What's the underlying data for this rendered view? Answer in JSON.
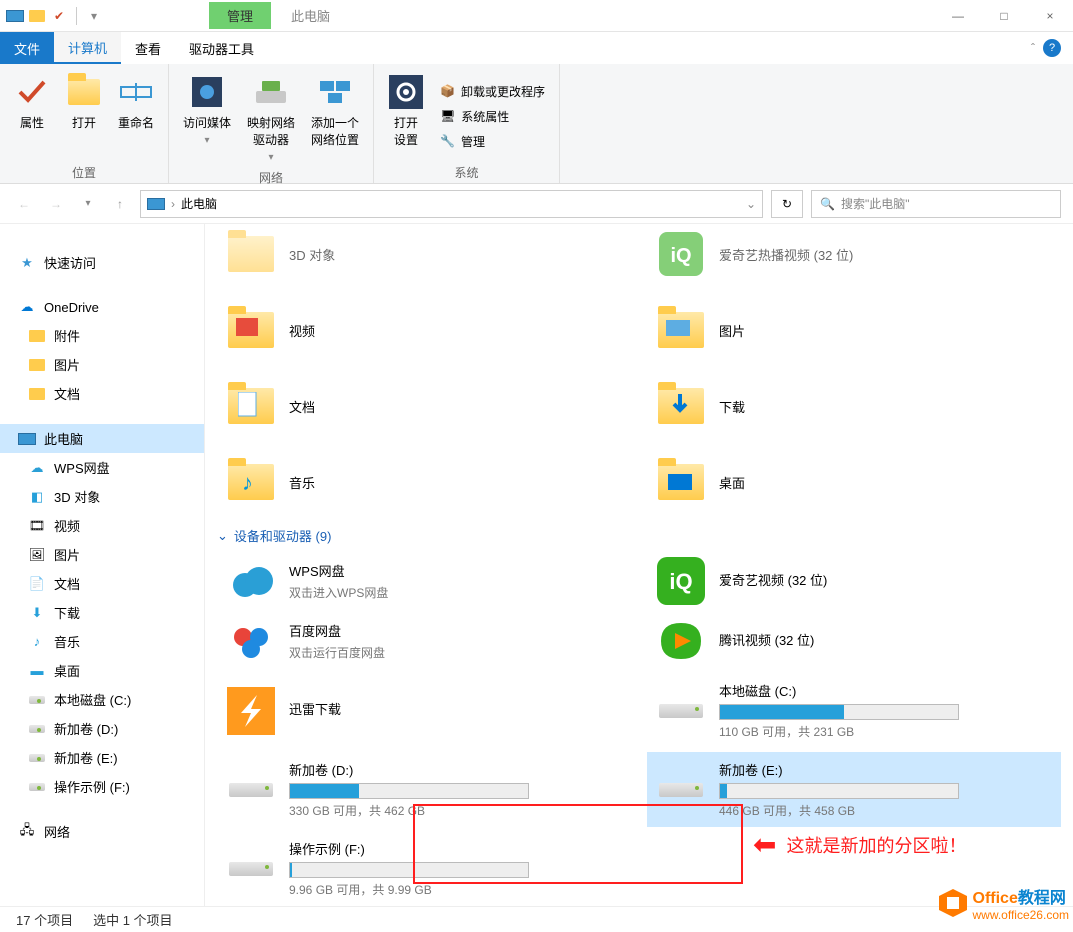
{
  "window": {
    "context_tab": "管理",
    "title": "此电脑",
    "min": "—",
    "max": "□",
    "close": "×"
  },
  "ribbon_tabs": {
    "file": "文件",
    "computer": "计算机",
    "view": "查看",
    "tools": "驱动器工具"
  },
  "ribbon": {
    "g1_label": "位置",
    "properties": "属性",
    "open": "打开",
    "rename": "重命名",
    "g2_label": "网络",
    "media": "访问媒体",
    "map_drive": "映射网络\n驱动器",
    "add_netloc": "添加一个\n网络位置",
    "g3_label": "系统",
    "open_settings": "打开\n设置",
    "uninstall": "卸载或更改程序",
    "sys_props": "系统属性",
    "manage": "管理"
  },
  "nav": {
    "crumb": "此电脑",
    "search_placeholder": "搜索\"此电脑\""
  },
  "sidebar": {
    "quick": "快速访问",
    "onedrive": "OneDrive",
    "od_attach": "附件",
    "od_pics": "图片",
    "od_docs": "文档",
    "this_pc": "此电脑",
    "wps": "WPS网盘",
    "obj3d": "3D 对象",
    "videos": "视频",
    "pics": "图片",
    "docs": "文档",
    "downloads": "下载",
    "music": "音乐",
    "desktop": "桌面",
    "drive_c": "本地磁盘 (C:)",
    "drive_d": "新加卷 (D:)",
    "drive_e": "新加卷 (E:)",
    "drive_f": "操作示例 (F:)",
    "network": "网络"
  },
  "content": {
    "row0a": "3D 对象",
    "row0b": "爱奇艺热播视频 (32 位)",
    "videos": "视频",
    "pics": "图片",
    "docs": "文档",
    "downloads": "下载",
    "music": "音乐",
    "desktop": "桌面",
    "section": "设备和驱动器 (9)",
    "wps_name": "WPS网盘",
    "wps_sub": "双击进入WPS网盘",
    "iqiyi_name": "爱奇艺视频 (32 位)",
    "baidu_name": "百度网盘",
    "baidu_sub": "双击运行百度网盘",
    "tencent_name": "腾讯视频 (32 位)",
    "xunlei_name": "迅雷下载",
    "drive_c_name": "本地磁盘 (C:)",
    "drive_c_text": "110 GB 可用，共 231 GB",
    "drive_c_pct": 52,
    "drive_d_name": "新加卷 (D:)",
    "drive_d_text": "330 GB 可用，共 462 GB",
    "drive_d_pct": 29,
    "drive_e_name": "新加卷 (E:)",
    "drive_e_text": "446 GB 可用，共 458 GB",
    "drive_e_pct": 3,
    "drive_f_name": "操作示例 (F:)",
    "drive_f_text": "9.96 GB 可用，共 9.99 GB",
    "drive_f_pct": 1
  },
  "annotation": "这就是新加的分区啦！",
  "statusbar": {
    "items": "17 个项目",
    "selected": "选中 1 个项目"
  },
  "watermark": {
    "brand": "Office教程网",
    "url": "www.office26.com"
  }
}
